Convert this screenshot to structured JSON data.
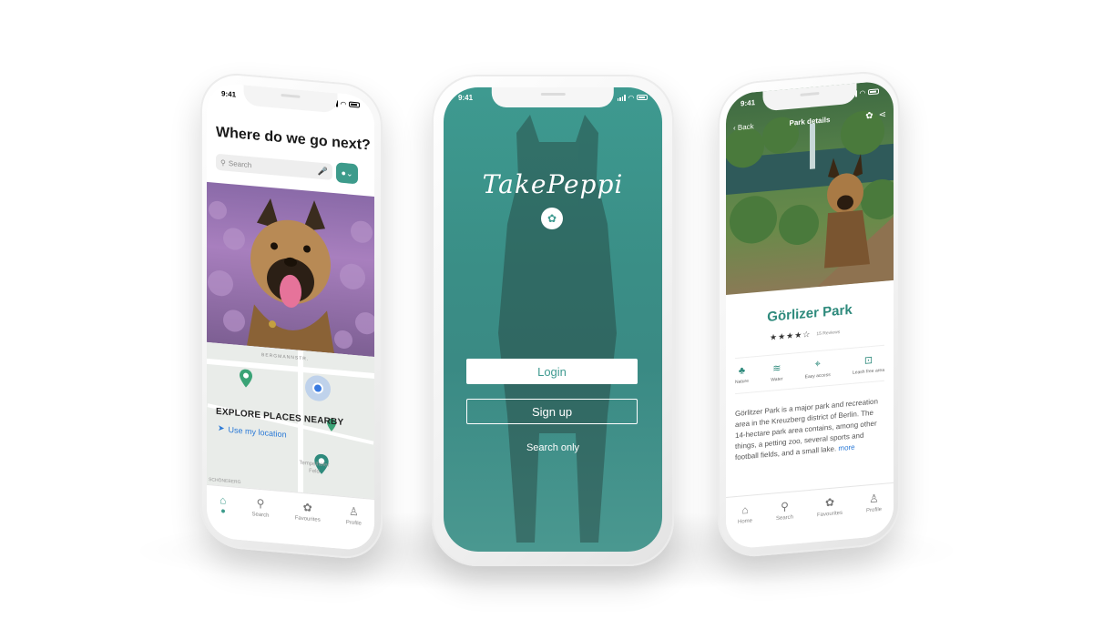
{
  "left_phone": {
    "time": "9:41",
    "heading": "Where do we go next?",
    "search_placeholder": "Search",
    "map_street": "BERGMANNSTR.",
    "map_place": "Tempelhofer Feld",
    "map_corner": "SCHÖNEBERG",
    "explore_title": "EXPLORE PLACES NEARBY",
    "use_location": "Use my location",
    "tabs": [
      {
        "label": "",
        "icon": "home-icon"
      },
      {
        "label": "Search",
        "icon": "search-icon"
      },
      {
        "label": "Favourites",
        "icon": "paw-icon"
      },
      {
        "label": "Profile",
        "icon": "profile-icon"
      }
    ]
  },
  "middle_phone": {
    "time": "9:41",
    "brand": "TakePeppi",
    "login_label": "Login",
    "signup_label": "Sign up",
    "search_only_label": "Search only"
  },
  "right_phone": {
    "time": "9:41",
    "back_label": "Back",
    "nav_title": "Park details",
    "park_name": "Görlizer Park",
    "stars": "★★★★☆",
    "reviews": "15 Reviews",
    "amenities": [
      {
        "label": "Nature",
        "icon": "tree-icon"
      },
      {
        "label": "Water",
        "icon": "water-icon"
      },
      {
        "label": "Easy access",
        "icon": "map-pin-icon"
      },
      {
        "label": "Leash free area",
        "icon": "leash-icon"
      }
    ],
    "description": "Görlitzer Park is a major park and recreation area in the Kreuzberg district of Berlin. The 14-hectare park area contains, among other things, a petting zoo, several sports and football fields, and a small lake.",
    "more_label": "more",
    "tabs": [
      {
        "label": "Home",
        "icon": "home-icon"
      },
      {
        "label": "Search",
        "icon": "search-icon"
      },
      {
        "label": "Favourites",
        "icon": "paw-icon"
      },
      {
        "label": "Profile",
        "icon": "profile-icon"
      }
    ]
  },
  "colors": {
    "accent": "#3d9b8b",
    "teal_bg": "#3e9a90",
    "link": "#2a79d6"
  }
}
